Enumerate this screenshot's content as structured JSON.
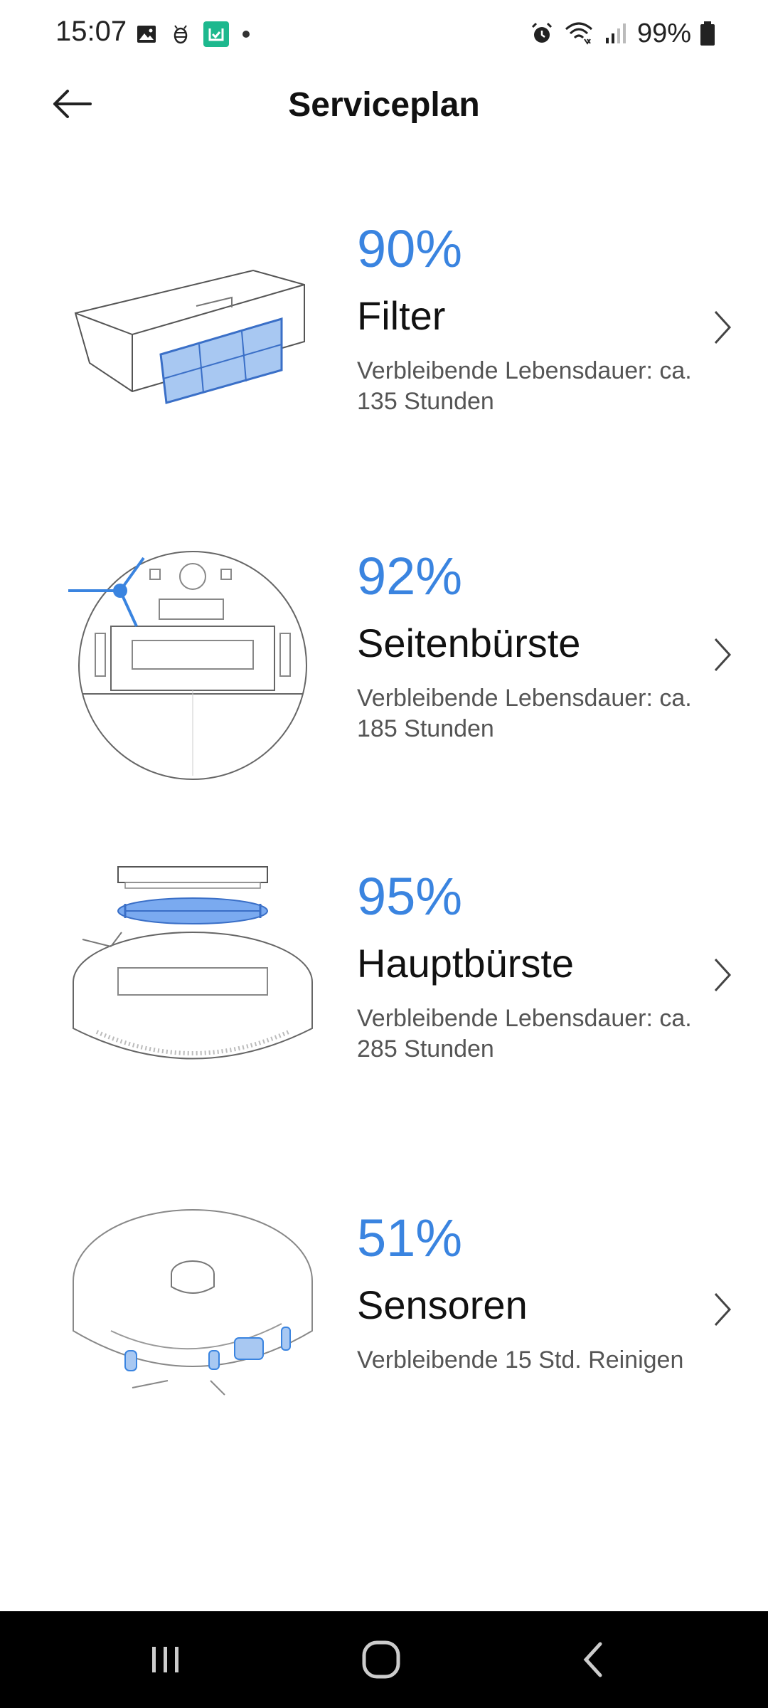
{
  "status_bar": {
    "time": "15:07",
    "battery": "99%",
    "left_icons": [
      "image-icon",
      "bug-icon",
      "mi-home-app-icon",
      "dot-icon"
    ],
    "right_icons": [
      "alarm-icon",
      "wifi-icon",
      "signal-icon",
      "battery-icon"
    ]
  },
  "header": {
    "title": "Serviceplan",
    "back_icon": "arrow-left-icon"
  },
  "accent_color": "#3a84e0",
  "items": [
    {
      "percent": "90%",
      "name": "Filter",
      "desc": "Verbleibende Lebensdauer: ca. 135 Stunden",
      "level": 0.9
    },
    {
      "percent": "92%",
      "name": "Seitenbürste",
      "desc": "Verbleibende Lebensdauer: ca. 185 Stunden",
      "level": 0.92
    },
    {
      "percent": "95%",
      "name": "Hauptbürste",
      "desc": "Verbleibende Lebensdauer: ca. 285 Stunden",
      "level": 0.95
    },
    {
      "percent": "51%",
      "name": "Sensoren",
      "desc": "Verbleibende 15 Std. Reinigen",
      "level": 0.51
    }
  ],
  "nav_bar": {
    "buttons": [
      "recent-apps-icon",
      "home-icon",
      "back-icon"
    ]
  }
}
